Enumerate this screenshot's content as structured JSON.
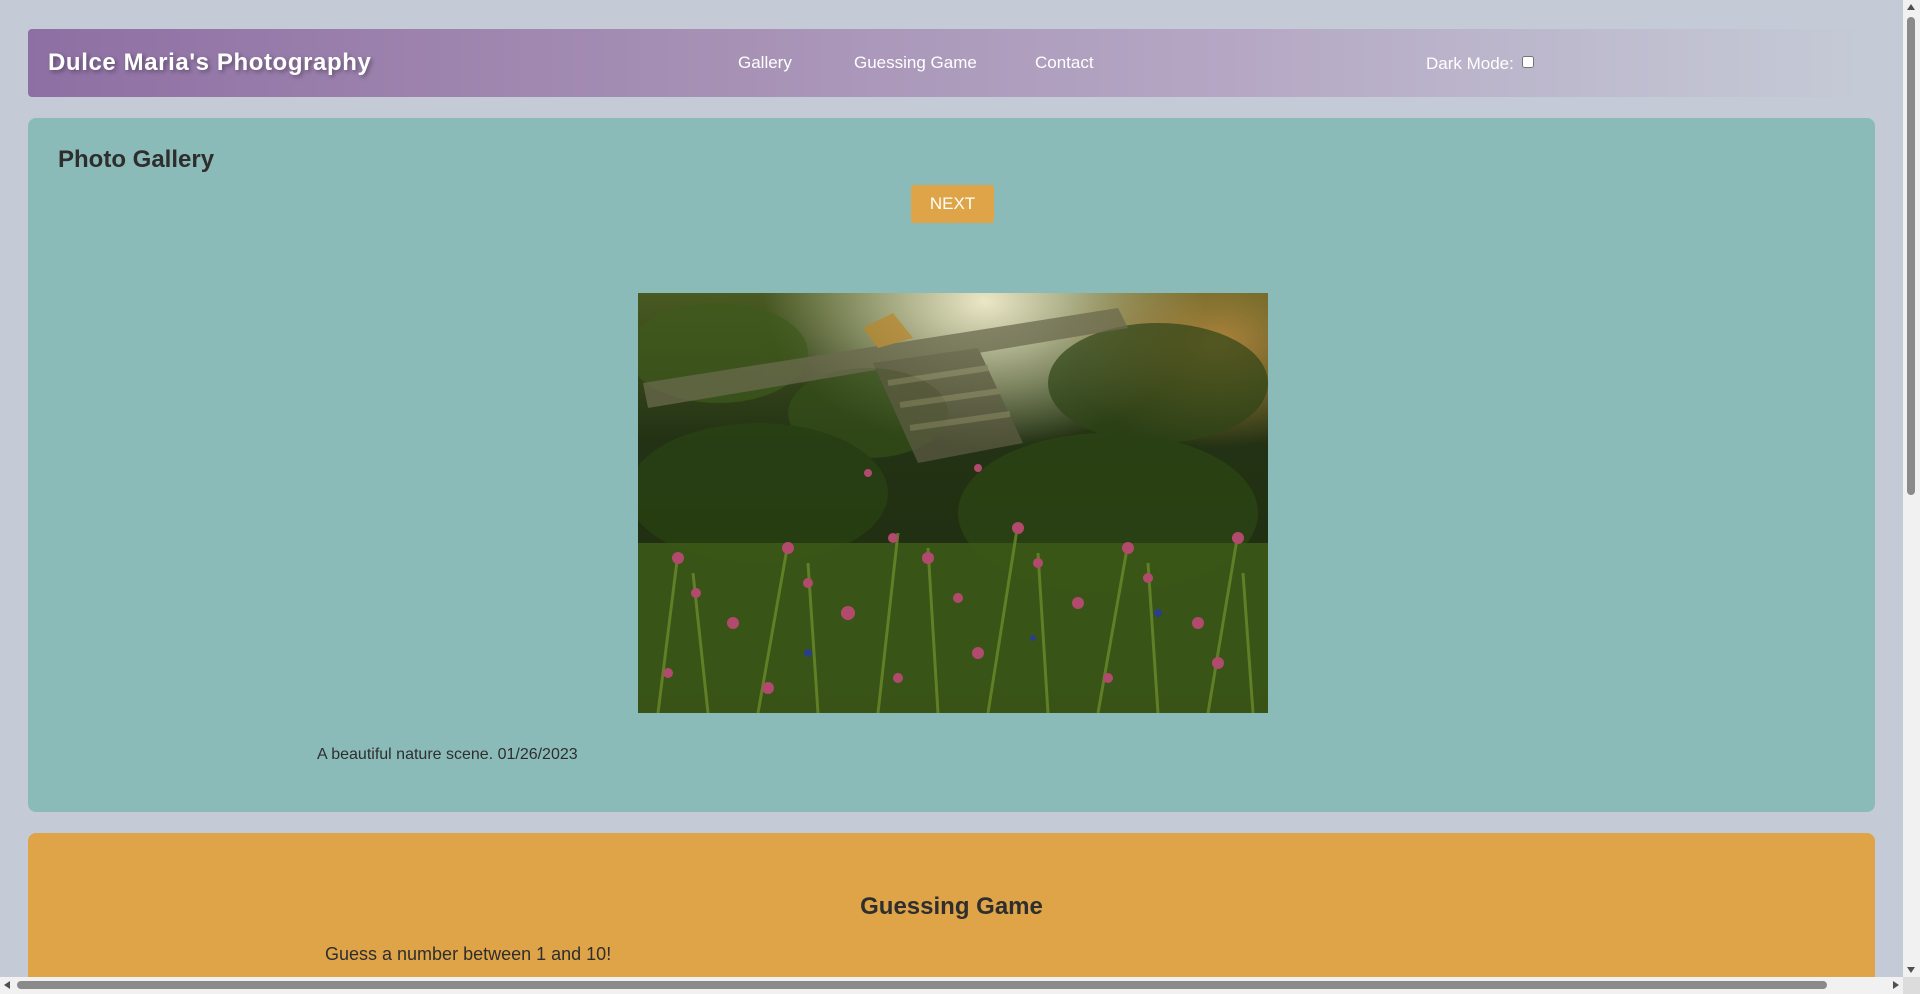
{
  "header": {
    "title": "Dulce Maria's Photography",
    "nav": [
      "Gallery",
      "Guessing Game",
      "Contact"
    ],
    "dark_mode_label": "Dark Mode:",
    "dark_mode_checked": false
  },
  "gallery": {
    "heading": "Photo Gallery",
    "next_label": "NEXT",
    "photo_icon": "photo-nature-scene",
    "caption": "A beautiful nature scene. 01/26/2023"
  },
  "game": {
    "heading": "Guessing Game",
    "prompt": "Guess a number between 1 and 10!"
  },
  "colors": {
    "page_bg": "#c5cbd6",
    "header_gradient_start": "#8e6fa3",
    "gallery_bg": "#8bbbb8",
    "accent": "#dea447"
  }
}
